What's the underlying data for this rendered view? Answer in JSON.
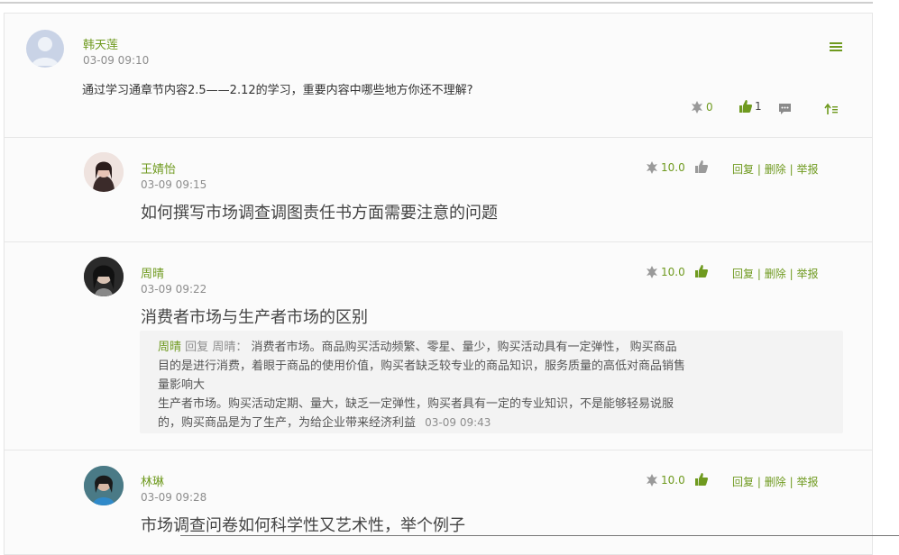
{
  "post": {
    "author": "韩天莲",
    "time": "03-09 09:10",
    "question": "通过学习通章节内容2.5——2.12的学习，重要内容中哪些地方你还不理解?",
    "flower_count": "0",
    "like_count": "1"
  },
  "comments": [
    {
      "author": "王婧怡",
      "time": "03-09 09:15",
      "text": "如何撰写市场调查调图责任书方面需要注意的问题",
      "score": "10.0",
      "reply_label": "回复",
      "delete_label": "删除",
      "report_label": "举报",
      "sep": "|"
    },
    {
      "author": "周晴",
      "time": "03-09 09:22",
      "text": "消费者市场与生产者市场的区别",
      "score": "10.0",
      "reply_label": "回复",
      "delete_label": "删除",
      "report_label": "举报",
      "sep": "|",
      "reply": {
        "from": "周晴",
        "verb": "回复",
        "to": "周晴：",
        "line1": "消费者市场。商品购买活动频繁、零星、量少，购买活动具有一定弹性， 购买商品",
        "line2": "目的是进行消费，着眼于商品的使用价值，购买者缺乏较专业的商品知识，服务质量的高低对商品销售",
        "line3": "量影响大",
        "line4": "生产者市场。购买活动定期、量大，缺乏一定弹性，购买者具有一定的专业知识，不是能够轻易说服",
        "line5": "的，购买商品是为了生产，为给企业带来经济利益",
        "time": "03-09 09:43"
      }
    },
    {
      "author": "林琳",
      "time": "03-09 09:28",
      "text": "市场调查问卷如何科学性又艺术性，举个例子",
      "score": "10.0",
      "reply_label": "回复",
      "delete_label": "删除",
      "report_label": "举报",
      "sep": "|"
    }
  ],
  "icons": [
    "menu-icon",
    "flower-icon",
    "thumbs-up-icon",
    "comment-icon",
    "sort-top-icon"
  ],
  "colors": {
    "accent": "#6f9a1f",
    "muted": "#8d8d8d",
    "liked": "#6f9a1f",
    "unliked": "#9a9a9a"
  }
}
